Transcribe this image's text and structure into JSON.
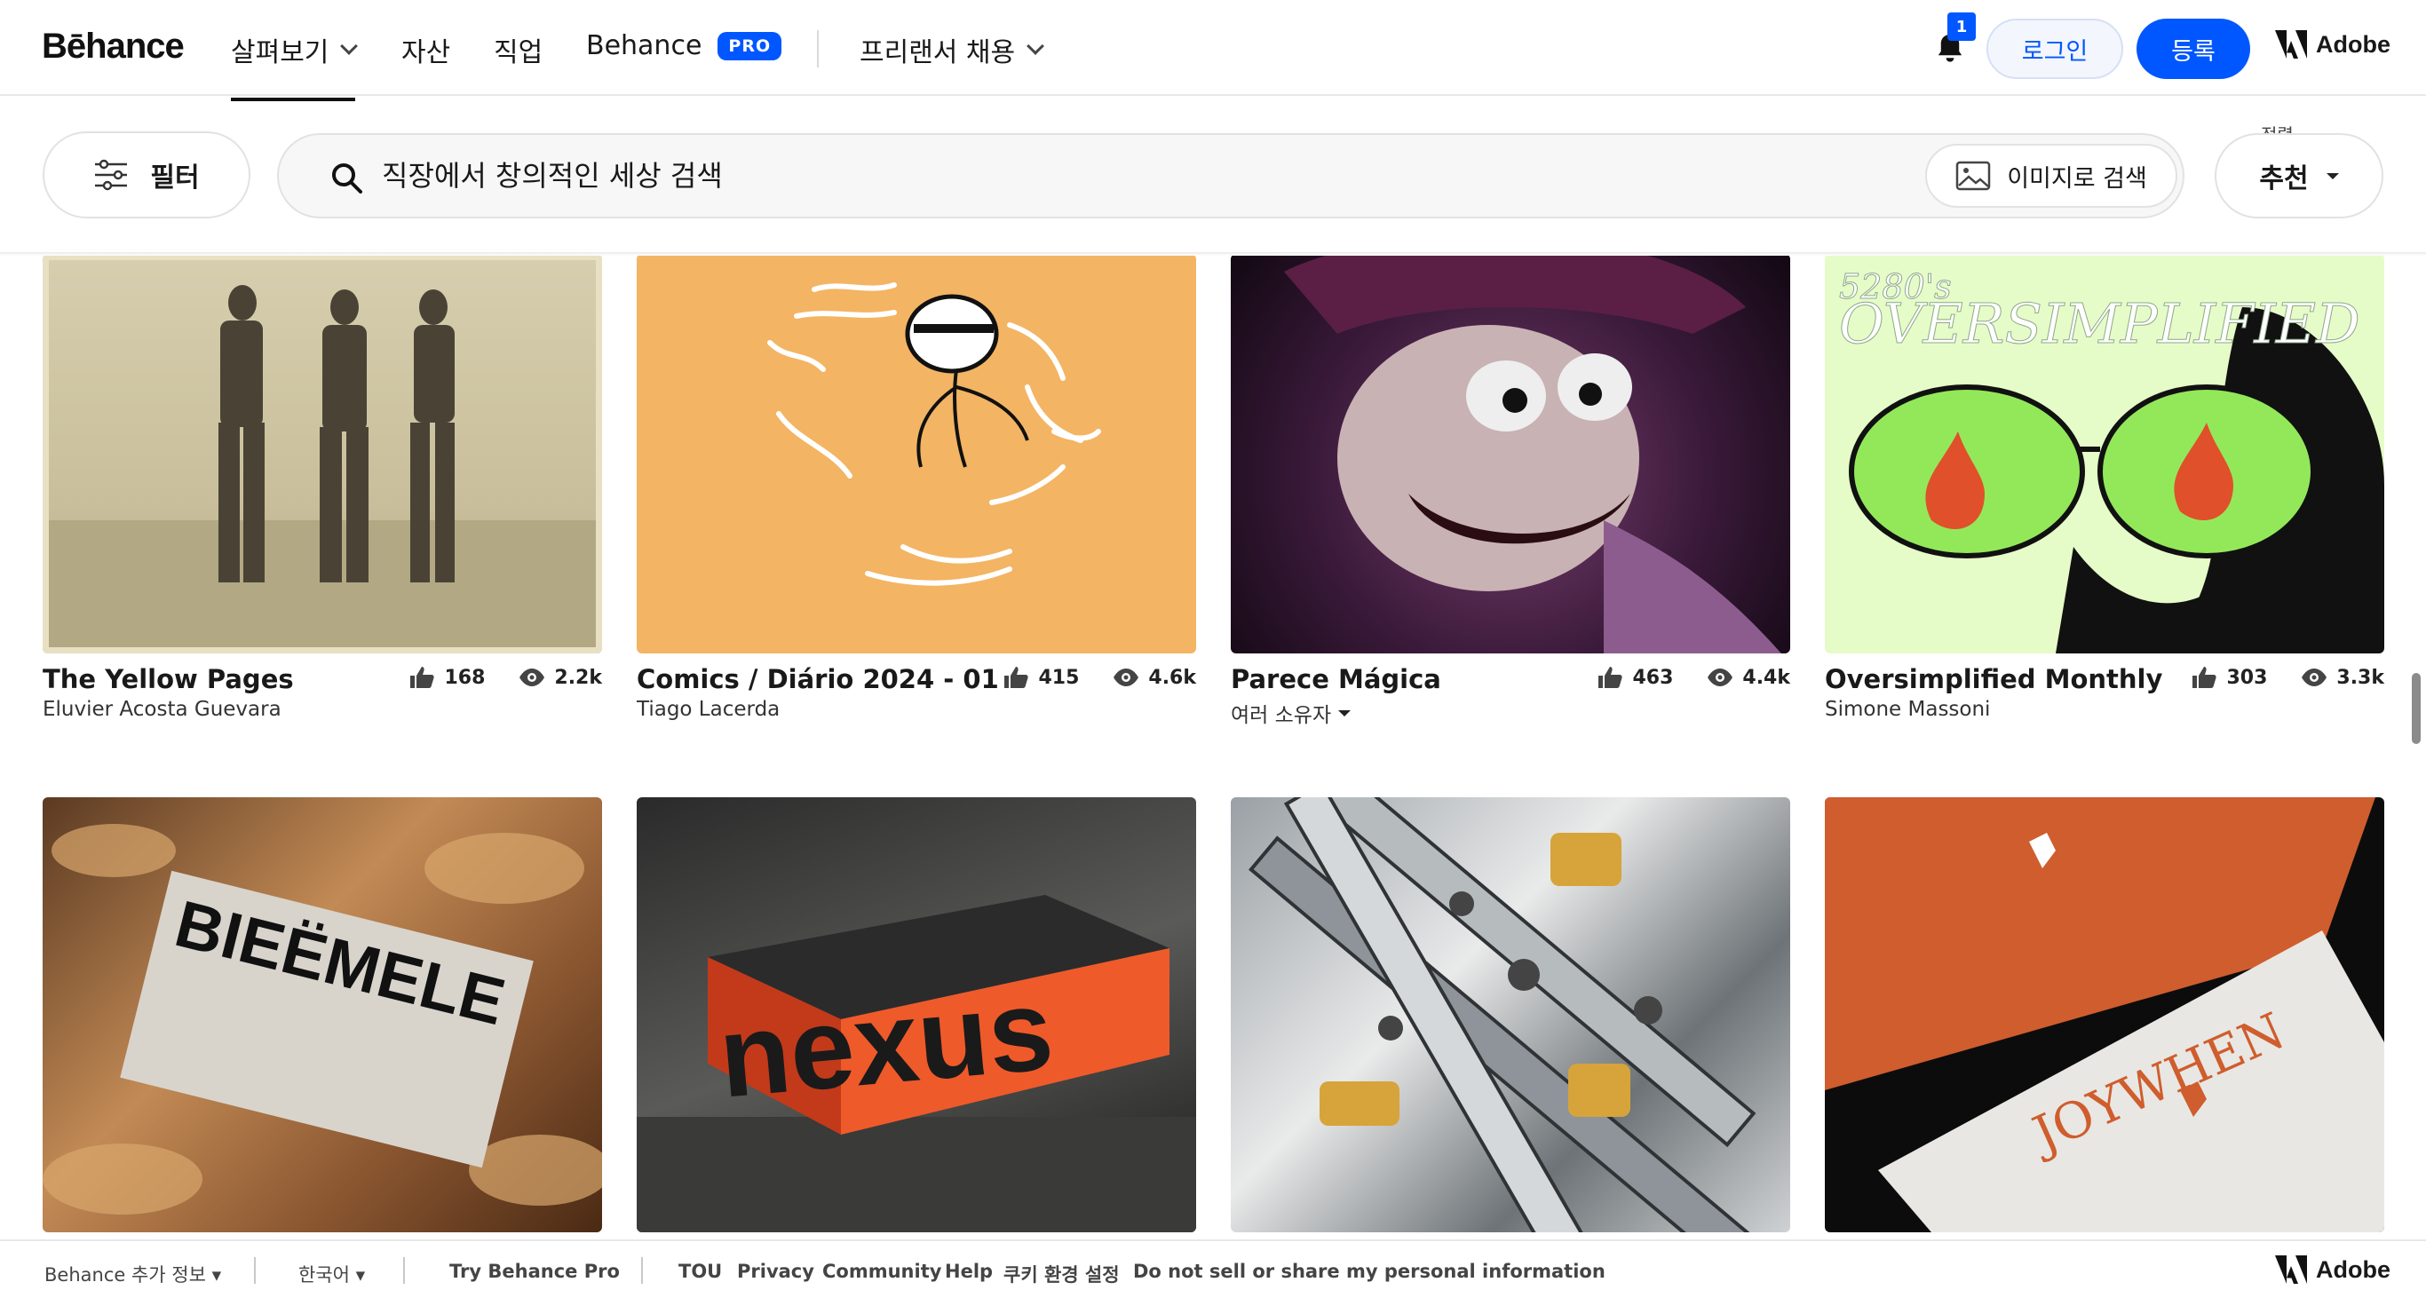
{
  "header": {
    "logo": "Bēhance",
    "nav": [
      {
        "label": "살펴보기"
      },
      {
        "label": "자산"
      },
      {
        "label": "직업"
      },
      {
        "label": "Behance"
      },
      {
        "label": "프리랜서 채용"
      }
    ],
    "pro_badge": "PRO",
    "notification_count": "1",
    "login_label": "로그인",
    "signup_label": "등록",
    "adobe_label": "Adobe"
  },
  "toolbar": {
    "filter_label": "필터",
    "search_placeholder": "직장에서 창의적인 세상 검색",
    "image_search_label": "이미지로 검색",
    "sort_caption": "정렬",
    "sort_value": "추천"
  },
  "projects": [
    {
      "title": "The Yellow Pages",
      "owner": "Eluvier Acosta Guevara",
      "likes": "168",
      "views": "2.2k",
      "thumb_icon": "fashion-photo-thumbnail"
    },
    {
      "title": "Comics / Diário 2024 - 01",
      "owner": "Tiago Lacerda",
      "likes": "415",
      "views": "4.6k",
      "thumb_icon": "swimming-comic-thumbnail"
    },
    {
      "title": "Parece Mágica",
      "owner": "여러 소유자",
      "likes": "463",
      "views": "4.4k",
      "thumb_icon": "puppet-face-thumbnail"
    },
    {
      "title": "Oversimplified Monthly",
      "owner": "Simone Massoni",
      "likes": "303",
      "views": "3.3k",
      "thumb_icon": "sunglasses-illustration-thumbnail"
    },
    {
      "title": "",
      "owner": "",
      "likes": "",
      "views": "",
      "thumb_icon": "business-card-thumbnail",
      "thumb_text": "BIEËMELE"
    },
    {
      "title": "",
      "owner": "",
      "likes": "",
      "views": "",
      "thumb_icon": "nexus-box-thumbnail",
      "thumb_text": "nexus"
    },
    {
      "title": "",
      "owner": "",
      "likes": "",
      "views": "",
      "thumb_icon": "metal-machine-thumbnail"
    },
    {
      "title": "",
      "owner": "",
      "likes": "",
      "views": "",
      "thumb_icon": "joywhen-cards-thumbnail",
      "thumb_text": "JOYWHEN"
    }
  ],
  "thumb_texts": {
    "oversimplified_small": "5280's",
    "oversimplified_big": "OVERSIMPLIFIED"
  },
  "footer": {
    "more_info": "Behance 추가 정보",
    "language": "한국어",
    "try_pro": "Try Behance Pro",
    "links": [
      "TOU",
      "Privacy",
      "Community",
      "Help",
      "쿠키 환경 설정",
      "Do not sell or share my personal information"
    ],
    "adobe_label": "Adobe"
  },
  "colors": {
    "accent": "#0057ff",
    "text": "#191919"
  }
}
